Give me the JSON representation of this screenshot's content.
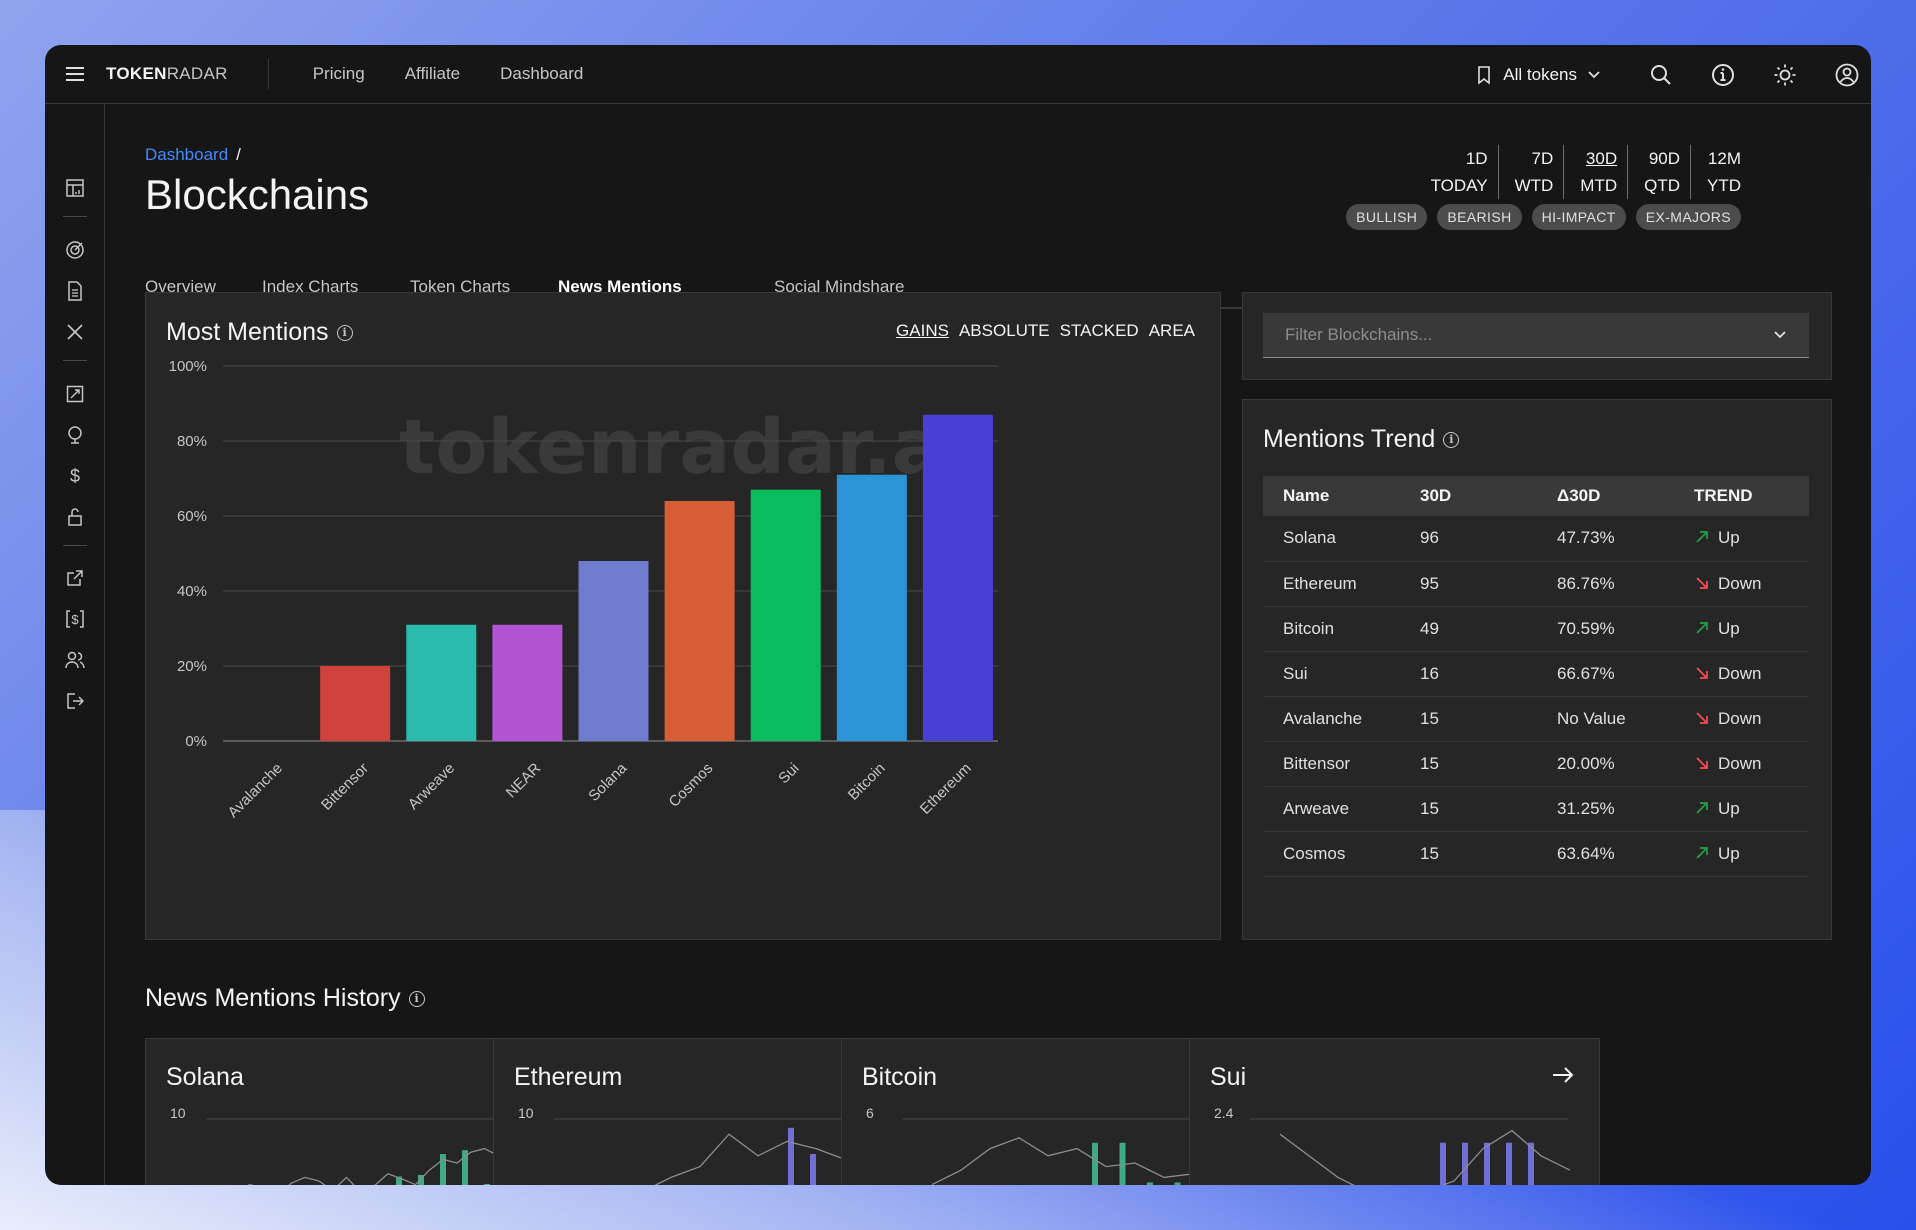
{
  "brand": {
    "part1": "TOKEN",
    "part2": "RADAR"
  },
  "nav": [
    {
      "label": "Pricing"
    },
    {
      "label": "Affiliate"
    },
    {
      "label": "Dashboard"
    }
  ],
  "token_selector": {
    "label": "All tokens"
  },
  "breadcrumb": {
    "parent": "Dashboard",
    "sep": "/"
  },
  "page_title": "Blockchains",
  "tabs": [
    {
      "label": "Overview"
    },
    {
      "label": "Index Charts"
    },
    {
      "label": "Token Charts"
    },
    {
      "label": "News Mentions",
      "active": true
    },
    {
      "label": "Social Mindshare"
    }
  ],
  "periods": [
    {
      "top": "1D",
      "bottom": "TODAY"
    },
    {
      "top": "7D",
      "bottom": "WTD"
    },
    {
      "top": "30D",
      "bottom": "MTD",
      "selected": true
    },
    {
      "top": "90D",
      "bottom": "QTD"
    },
    {
      "top": "12M",
      "bottom": "YTD"
    }
  ],
  "chips": [
    "BULLISH",
    "BEARISH",
    "HI-IMPACT",
    "EX-MAJORS"
  ],
  "most_mentions": {
    "title": "Most Mentions",
    "toggles": [
      {
        "label": "GAINS",
        "active": true
      },
      {
        "label": "ABSOLUTE"
      },
      {
        "label": "STACKED"
      },
      {
        "label": "AREA"
      }
    ],
    "watermark": "tokenradar.ai"
  },
  "chart_data": {
    "type": "bar",
    "categories": [
      "Avalanche",
      "Bittensor",
      "Arweave",
      "NEAR",
      "Solana",
      "Cosmos",
      "Sui",
      "Bitcoin",
      "Ethereum"
    ],
    "values": [
      0,
      20,
      31,
      31,
      48,
      64,
      67,
      71,
      87
    ],
    "colors": [
      "#8a6fdf",
      "#d0423b",
      "#2bbbad",
      "#b155d4",
      "#6f7bcc",
      "#d65d35",
      "#09bd5f",
      "#2a94d6",
      "#4a3fd4"
    ],
    "yticks": [
      "0%",
      "20%",
      "40%",
      "60%",
      "80%",
      "100%"
    ],
    "ylim": [
      0,
      100
    ],
    "grid": true
  },
  "filter": {
    "placeholder": "Filter Blockchains..."
  },
  "trend": {
    "title": "Mentions Trend",
    "headers": [
      "Name",
      "30D",
      "Δ30D",
      "TREND"
    ],
    "rows": [
      {
        "name": "Solana",
        "d30": "96",
        "delta": "47.73%",
        "trend": "Up"
      },
      {
        "name": "Ethereum",
        "d30": "95",
        "delta": "86.76%",
        "trend": "Down"
      },
      {
        "name": "Bitcoin",
        "d30": "49",
        "delta": "70.59%",
        "trend": "Up"
      },
      {
        "name": "Sui",
        "d30": "16",
        "delta": "66.67%",
        "trend": "Down"
      },
      {
        "name": "Avalanche",
        "d30": "15",
        "delta": "No Value",
        "trend": "Down"
      },
      {
        "name": "Bittensor",
        "d30": "15",
        "delta": "20.00%",
        "trend": "Down"
      },
      {
        "name": "Arweave",
        "d30": "15",
        "delta": "31.25%",
        "trend": "Up"
      },
      {
        "name": "Cosmos",
        "d30": "15",
        "delta": "63.64%",
        "trend": "Up"
      }
    ]
  },
  "history": {
    "title": "News Mentions History",
    "cards": [
      {
        "name": "Solana",
        "ymax": "10",
        "bar_color": "#3fa98a",
        "line": [
          0.1,
          0.2,
          0.15,
          0.05,
          0.22,
          0.3,
          0.25,
          0.12,
          0.3,
          0.1,
          0.18,
          0.35,
          0.28,
          0.2,
          0.4,
          0.55,
          0.5,
          0.65,
          0.7,
          0.6,
          0.75,
          0.8
        ],
        "bars": [
          0.3,
          0.32,
          0.6,
          0.65,
          0.2
        ]
      },
      {
        "name": "Ethereum",
        "ymax": "10",
        "bar_color": "#6f6fd6",
        "line": [
          0.05,
          0.08,
          0.1,
          0.3,
          0.45,
          0.9,
          0.6,
          0.8,
          0.7,
          0.55,
          0.75
        ],
        "bars": [
          0.1,
          0.15,
          0.95,
          0.6,
          0.12
        ]
      },
      {
        "name": "Bitcoin",
        "ymax": "6",
        "bar_color": "#3fa98a",
        "line": [
          0.2,
          0.4,
          0.7,
          0.85,
          0.6,
          0.7,
          0.45,
          0.5,
          0.3,
          0.35,
          0.2
        ],
        "bars": [
          0.75,
          0.75,
          0.22,
          0.22
        ]
      },
      {
        "name": "Sui",
        "ymax": "2.4",
        "bar_color": "#6f6fd6",
        "line": [
          0.9,
          0.6,
          0.3,
          0.1,
          0.05,
          0.1,
          0.25,
          0.7,
          0.95,
          0.6,
          0.4
        ],
        "bars": [
          0.75,
          0.75,
          0.75,
          0.75,
          0.75
        ]
      }
    ]
  }
}
